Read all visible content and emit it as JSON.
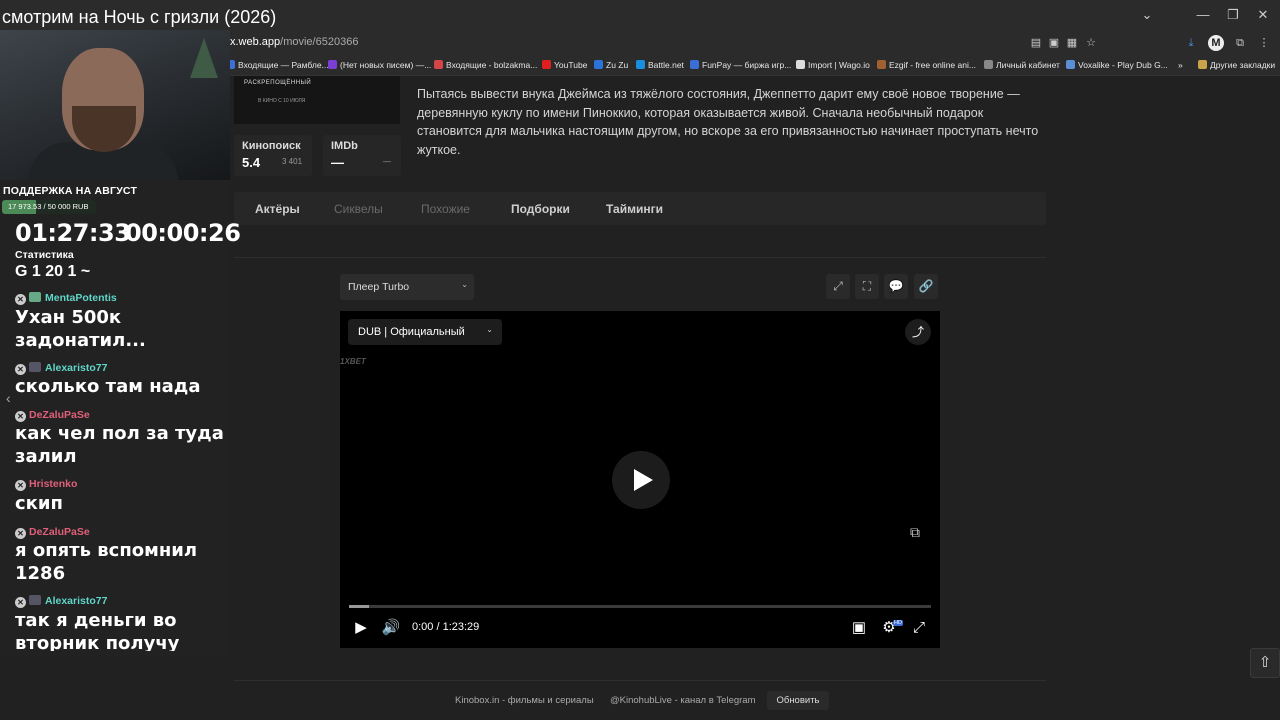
{
  "stream_title": "смотрим на Ночь с гризли (2026)",
  "browser": {
    "url_host": "x.web.app",
    "url_path": "/movie/6520366",
    "bookmarks": [
      {
        "label": "Входящие — Рамбле...",
        "color": "#3d6fd6"
      },
      {
        "label": "(Нет новых писем) —...",
        "color": "#7b3fd6"
      },
      {
        "label": "Входящие - bolzakma...",
        "color": "#d64545"
      },
      {
        "label": "YouTube",
        "color": "#e02020"
      },
      {
        "label": "Zu Zu",
        "color": "#2a73d8"
      },
      {
        "label": "Battle.net",
        "color": "#1a8fe0"
      },
      {
        "label": "FunPay — биржа игр...",
        "color": "#3b6fd6"
      },
      {
        "label": "Import | Wago.io",
        "color": "#dddddd"
      },
      {
        "label": "Ezgif - free online ani...",
        "color": "#a06030"
      },
      {
        "label": "Личный кабинет",
        "color": "#888888"
      },
      {
        "label": "Voxalike - Play Dub G...",
        "color": "#5a8fd6"
      }
    ],
    "other_bookmarks": "Другие закладки"
  },
  "movie": {
    "poster_tag": "РАСКРЕПОЩЁННЫЙ",
    "poster_date": "В КИНО С 10 ИЮЛЯ",
    "synopsis": "Пытаясь вывести внука Джеймса из тяжёлого состояния, Джеппетто дарит ему своё новое творение — деревянную куклу по имени Пиноккио, которая оказывается живой. Сначала необычный подарок становится для мальчика настоящим другом, но вскоре за его привязанностью начинает проступать нечто жуткое.",
    "ratings": [
      {
        "name": "Кинопоиск",
        "value": "5.4",
        "count": "3 401"
      },
      {
        "name": "IMDb",
        "value": "—",
        "count": "—"
      }
    ],
    "tabs": [
      {
        "label": "Актёры",
        "color": "#cfcfcf"
      },
      {
        "label": "Сиквелы",
        "color": "#6a6a6a"
      },
      {
        "label": "Похожие",
        "color": "#6a6a6a"
      },
      {
        "label": "Подборки",
        "color": "#cfcfcf"
      },
      {
        "label": "Тайминги",
        "color": "#cfcfcf"
      }
    ]
  },
  "player": {
    "select_label": "Плеер Turbo",
    "dub_label": "DUB | Официальный",
    "brand": "1XBET",
    "time_current": "0:00",
    "time_total": "1:23:29",
    "time_readout": "0:00 / 1:23:29",
    "progress_fraction": 0.035,
    "hd_badge": "HD"
  },
  "footer": {
    "link1": "Kinobox.in - фильмы и сериалы",
    "link2": "@KinohubLive - канал в Telegram",
    "refresh": "Обновить"
  },
  "overlay": {
    "support_title": "ПОДДЕРЖКА НА АВГУСТ",
    "support_amount": "17 973.53 / 50 000 RUB",
    "support_fraction": 0.36,
    "timer_left": "01:27:33",
    "timer_right": "00:00:26",
    "stats_label": "Статистика",
    "stats_line": "G 1  20  1  ~",
    "chat": [
      {
        "user": "MentaPotentis",
        "color": "#5fd6c8",
        "msg": "Ухан 500к задонатил..."
      },
      {
        "user": "Alexaristo77",
        "color": "#5fd6c8",
        "msg": "сколько там нада"
      },
      {
        "user": "DeZaluPaSe",
        "color": "#e0607a",
        "msg": "как чел пол за туда залил"
      },
      {
        "user": "Hristenko",
        "color": "#e0607a",
        "msg": "скип"
      },
      {
        "user": "DeZaluPaSe",
        "color": "#e0607a",
        "msg": "я опять вспомнил 1286"
      },
      {
        "user": "Alexaristo77",
        "color": "#5fd6c8",
        "msg": "так я деньги во вторник получу"
      }
    ]
  }
}
